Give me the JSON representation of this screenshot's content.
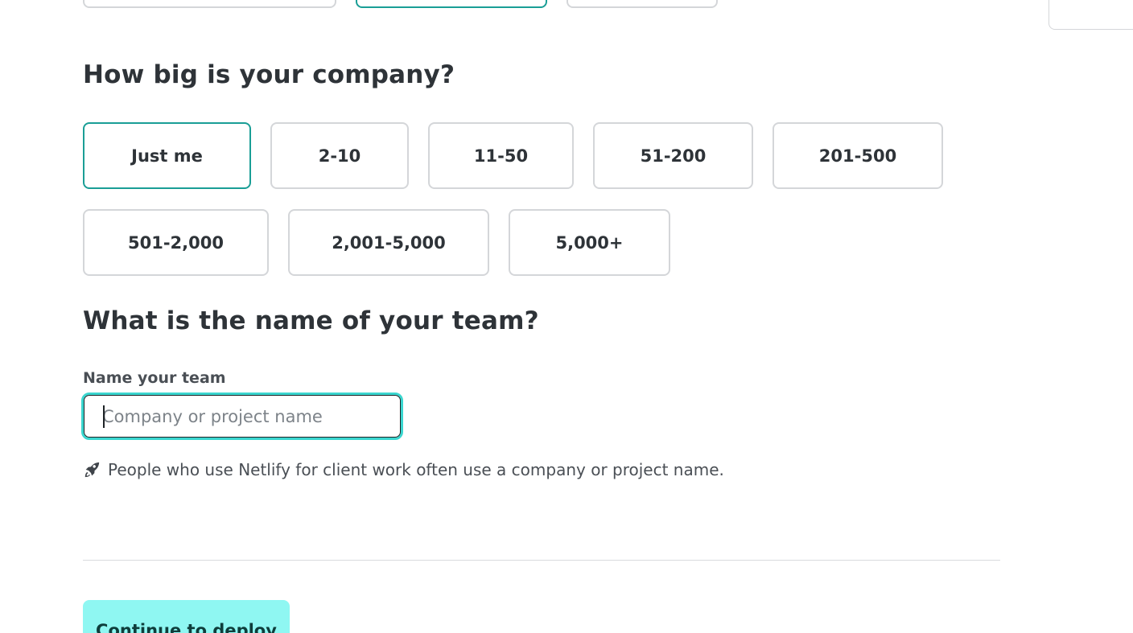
{
  "previous_question": {
    "options": [
      {
        "state": "unselected"
      },
      {
        "state": "selected"
      },
      {
        "state": "unselected"
      }
    ]
  },
  "company_size": {
    "heading": "How big is your company?",
    "selected": "Just me",
    "options": [
      {
        "label": "Just me"
      },
      {
        "label": "2-10"
      },
      {
        "label": "11-50"
      },
      {
        "label": "51-200"
      },
      {
        "label": "201-500"
      },
      {
        "label": "501-2,000"
      },
      {
        "label": "2,001-5,000"
      },
      {
        "label": "5,000+"
      }
    ]
  },
  "team_name": {
    "heading": "What is the name of your team?",
    "label": "Name your team",
    "value": "",
    "placeholder": "Company or project name",
    "hint_icon": "rocket-icon",
    "hint": "People who use Netlify for client work often use a company or project name."
  },
  "footer": {
    "continue_label": "Continue to deploy"
  },
  "colors": {
    "accent_border": "#1a9e96",
    "focus_ring": "#3ad6cf",
    "primary_button_bg": "#8ff7f2",
    "text": "#2e3338"
  }
}
